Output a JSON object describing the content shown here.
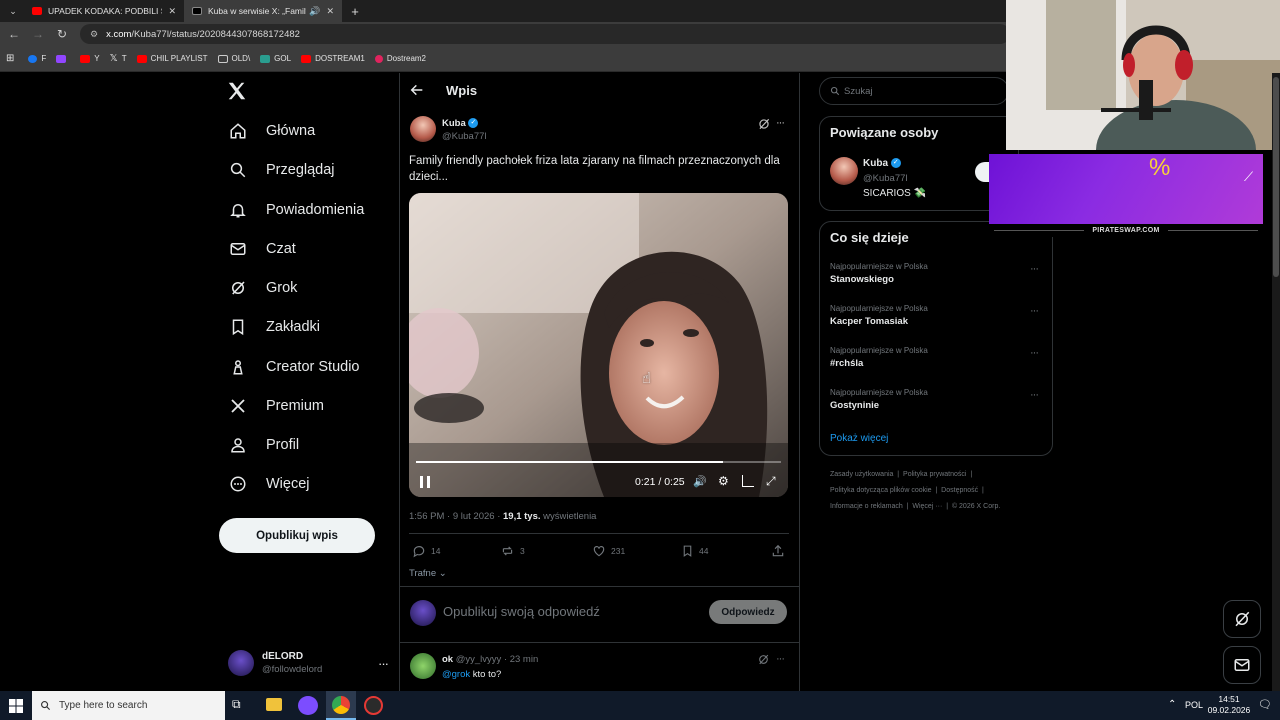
{
  "browser": {
    "tabs": [
      {
        "title": "UPADEK KODAKA: PODBILI ŚW",
        "active": false
      },
      {
        "title": "Kuba w serwisie X: „Family f",
        "active": true
      }
    ],
    "url_host": "x.com",
    "url_path": "/Kuba77l/status/2020844307868172482",
    "bookmarks": [
      "F",
      "Y",
      "T",
      "CHIL PLAYLIST",
      "OLD\\",
      "GOL",
      "DOSTREAM1",
      "Dostream2"
    ]
  },
  "sidebar": {
    "items": [
      {
        "label": "Główna",
        "icon": "home-icon"
      },
      {
        "label": "Przeglądaj",
        "icon": "search-icon"
      },
      {
        "label": "Powiadomienia",
        "icon": "bell-icon"
      },
      {
        "label": "Czat",
        "icon": "mail-icon"
      },
      {
        "label": "Grok",
        "icon": "grok-icon"
      },
      {
        "label": "Zakładki",
        "icon": "bookmark-icon"
      },
      {
        "label": "Creator Studio",
        "icon": "creator-icon"
      },
      {
        "label": "Premium",
        "icon": "x-premium-icon"
      },
      {
        "label": "Profil",
        "icon": "profile-icon"
      },
      {
        "label": "Więcej",
        "icon": "more-circle-icon"
      }
    ],
    "post_button": "Opublikuj wpis",
    "account": {
      "name": "dELORD",
      "handle": "@followdelord"
    }
  },
  "post_page": {
    "header_title": "Wpis",
    "author": {
      "name": "Kuba",
      "handle": "@Kuba77l"
    },
    "text": "Family friendly pachołek friza lata zjarany na filmach przeznaczonych dla dzieci...",
    "video": {
      "time": "0:21 / 0:25",
      "progress": 0.84
    },
    "meta": {
      "time": "1:56 PM · 9 lut 2026 · ",
      "views": "19,1 tys.",
      "views_label": " wyświetlenia"
    },
    "stats": {
      "replies": "14",
      "reposts": "3",
      "likes": "231",
      "bookmarks": "44"
    },
    "sort_label": "Trafne",
    "reply_placeholder": "Opublikuj swoją odpowiedź",
    "reply_button": "Odpowiedz",
    "reply": {
      "name": "ok",
      "handle": "@yy_lvyyy",
      "time": "· 23 min",
      "mention": "@grok",
      "text": " kto to?"
    }
  },
  "right": {
    "search_placeholder": "Szukaj",
    "related_title": "Powiązane osoby",
    "related": {
      "name": "Kuba",
      "handle": "@Kuba77l",
      "bio": "SICARIOS 💸"
    },
    "trends_title": "Co się dzieje",
    "trends": [
      {
        "category": "Najpopularniejsze w Polska",
        "name": "Stanowskiego"
      },
      {
        "category": "Najpopularniejsze w Polska",
        "name": "Kacper Tomasiak"
      },
      {
        "category": "Najpopularniejsze w Polska",
        "name": "#rchśla"
      },
      {
        "category": "Najpopularniejsze w Polska",
        "name": "Gostyninie"
      }
    ],
    "show_more": "Pokaż więcej",
    "footer": {
      "l1a": "Zasady użytkowania",
      "l1b": "Polityka prywatności",
      "l2a": "Polityka dotycząca plików cookie",
      "l2b": "Dostępność",
      "l3a": "Informacje o reklamach",
      "l3b": "Więcej ···",
      "l3c": "© 2026 X Corp."
    }
  },
  "overlay": {
    "banner_text": "PIRATESWAP.COM"
  },
  "taskbar": {
    "search_placeholder": "Type here to search",
    "lang": "POL",
    "time": "14:51",
    "date": "09.02.2026"
  },
  "colors": {
    "accent": "#1d9bf0",
    "background": "#000000",
    "border": "#2f3336",
    "overlay_purple": "#8a2be2"
  }
}
